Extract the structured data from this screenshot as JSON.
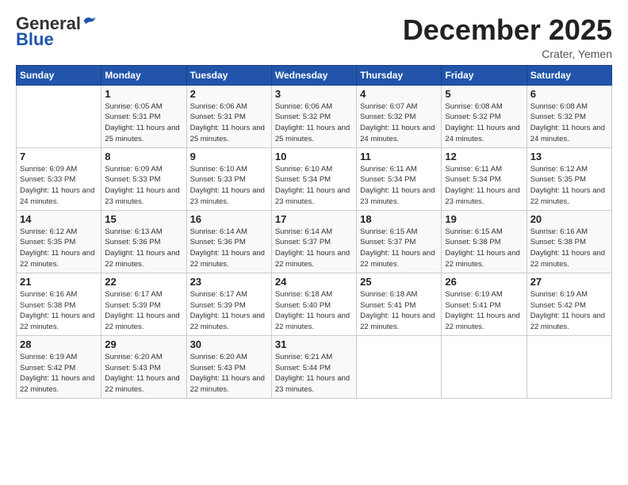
{
  "app": {
    "logo_general": "General",
    "logo_blue": "Blue",
    "month_title": "December 2025",
    "location": "Crater, Yemen"
  },
  "calendar": {
    "headers": [
      "Sunday",
      "Monday",
      "Tuesday",
      "Wednesday",
      "Thursday",
      "Friday",
      "Saturday"
    ],
    "weeks": [
      [
        {
          "day": "",
          "sunrise": "",
          "sunset": "",
          "daylight": ""
        },
        {
          "day": "1",
          "sunrise": "Sunrise: 6:05 AM",
          "sunset": "Sunset: 5:31 PM",
          "daylight": "Daylight: 11 hours and 25 minutes."
        },
        {
          "day": "2",
          "sunrise": "Sunrise: 6:06 AM",
          "sunset": "Sunset: 5:31 PM",
          "daylight": "Daylight: 11 hours and 25 minutes."
        },
        {
          "day": "3",
          "sunrise": "Sunrise: 6:06 AM",
          "sunset": "Sunset: 5:32 PM",
          "daylight": "Daylight: 11 hours and 25 minutes."
        },
        {
          "day": "4",
          "sunrise": "Sunrise: 6:07 AM",
          "sunset": "Sunset: 5:32 PM",
          "daylight": "Daylight: 11 hours and 24 minutes."
        },
        {
          "day": "5",
          "sunrise": "Sunrise: 6:08 AM",
          "sunset": "Sunset: 5:32 PM",
          "daylight": "Daylight: 11 hours and 24 minutes."
        },
        {
          "day": "6",
          "sunrise": "Sunrise: 6:08 AM",
          "sunset": "Sunset: 5:32 PM",
          "daylight": "Daylight: 11 hours and 24 minutes."
        }
      ],
      [
        {
          "day": "7",
          "sunrise": "Sunrise: 6:09 AM",
          "sunset": "Sunset: 5:33 PM",
          "daylight": "Daylight: 11 hours and 24 minutes."
        },
        {
          "day": "8",
          "sunrise": "Sunrise: 6:09 AM",
          "sunset": "Sunset: 5:33 PM",
          "daylight": "Daylight: 11 hours and 23 minutes."
        },
        {
          "day": "9",
          "sunrise": "Sunrise: 6:10 AM",
          "sunset": "Sunset: 5:33 PM",
          "daylight": "Daylight: 11 hours and 23 minutes."
        },
        {
          "day": "10",
          "sunrise": "Sunrise: 6:10 AM",
          "sunset": "Sunset: 5:34 PM",
          "daylight": "Daylight: 11 hours and 23 minutes."
        },
        {
          "day": "11",
          "sunrise": "Sunrise: 6:11 AM",
          "sunset": "Sunset: 5:34 PM",
          "daylight": "Daylight: 11 hours and 23 minutes."
        },
        {
          "day": "12",
          "sunrise": "Sunrise: 6:11 AM",
          "sunset": "Sunset: 5:34 PM",
          "daylight": "Daylight: 11 hours and 23 minutes."
        },
        {
          "day": "13",
          "sunrise": "Sunrise: 6:12 AM",
          "sunset": "Sunset: 5:35 PM",
          "daylight": "Daylight: 11 hours and 22 minutes."
        }
      ],
      [
        {
          "day": "14",
          "sunrise": "Sunrise: 6:12 AM",
          "sunset": "Sunset: 5:35 PM",
          "daylight": "Daylight: 11 hours and 22 minutes."
        },
        {
          "day": "15",
          "sunrise": "Sunrise: 6:13 AM",
          "sunset": "Sunset: 5:36 PM",
          "daylight": "Daylight: 11 hours and 22 minutes."
        },
        {
          "day": "16",
          "sunrise": "Sunrise: 6:14 AM",
          "sunset": "Sunset: 5:36 PM",
          "daylight": "Daylight: 11 hours and 22 minutes."
        },
        {
          "day": "17",
          "sunrise": "Sunrise: 6:14 AM",
          "sunset": "Sunset: 5:37 PM",
          "daylight": "Daylight: 11 hours and 22 minutes."
        },
        {
          "day": "18",
          "sunrise": "Sunrise: 6:15 AM",
          "sunset": "Sunset: 5:37 PM",
          "daylight": "Daylight: 11 hours and 22 minutes."
        },
        {
          "day": "19",
          "sunrise": "Sunrise: 6:15 AM",
          "sunset": "Sunset: 5:38 PM",
          "daylight": "Daylight: 11 hours and 22 minutes."
        },
        {
          "day": "20",
          "sunrise": "Sunrise: 6:16 AM",
          "sunset": "Sunset: 5:38 PM",
          "daylight": "Daylight: 11 hours and 22 minutes."
        }
      ],
      [
        {
          "day": "21",
          "sunrise": "Sunrise: 6:16 AM",
          "sunset": "Sunset: 5:38 PM",
          "daylight": "Daylight: 11 hours and 22 minutes."
        },
        {
          "day": "22",
          "sunrise": "Sunrise: 6:17 AM",
          "sunset": "Sunset: 5:39 PM",
          "daylight": "Daylight: 11 hours and 22 minutes."
        },
        {
          "day": "23",
          "sunrise": "Sunrise: 6:17 AM",
          "sunset": "Sunset: 5:39 PM",
          "daylight": "Daylight: 11 hours and 22 minutes."
        },
        {
          "day": "24",
          "sunrise": "Sunrise: 6:18 AM",
          "sunset": "Sunset: 5:40 PM",
          "daylight": "Daylight: 11 hours and 22 minutes."
        },
        {
          "day": "25",
          "sunrise": "Sunrise: 6:18 AM",
          "sunset": "Sunset: 5:41 PM",
          "daylight": "Daylight: 11 hours and 22 minutes."
        },
        {
          "day": "26",
          "sunrise": "Sunrise: 6:19 AM",
          "sunset": "Sunset: 5:41 PM",
          "daylight": "Daylight: 11 hours and 22 minutes."
        },
        {
          "day": "27",
          "sunrise": "Sunrise: 6:19 AM",
          "sunset": "Sunset: 5:42 PM",
          "daylight": "Daylight: 11 hours and 22 minutes."
        }
      ],
      [
        {
          "day": "28",
          "sunrise": "Sunrise: 6:19 AM",
          "sunset": "Sunset: 5:42 PM",
          "daylight": "Daylight: 11 hours and 22 minutes."
        },
        {
          "day": "29",
          "sunrise": "Sunrise: 6:20 AM",
          "sunset": "Sunset: 5:43 PM",
          "daylight": "Daylight: 11 hours and 22 minutes."
        },
        {
          "day": "30",
          "sunrise": "Sunrise: 6:20 AM",
          "sunset": "Sunset: 5:43 PM",
          "daylight": "Daylight: 11 hours and 22 minutes."
        },
        {
          "day": "31",
          "sunrise": "Sunrise: 6:21 AM",
          "sunset": "Sunset: 5:44 PM",
          "daylight": "Daylight: 11 hours and 23 minutes."
        },
        {
          "day": "",
          "sunrise": "",
          "sunset": "",
          "daylight": ""
        },
        {
          "day": "",
          "sunrise": "",
          "sunset": "",
          "daylight": ""
        },
        {
          "day": "",
          "sunrise": "",
          "sunset": "",
          "daylight": ""
        }
      ]
    ]
  }
}
